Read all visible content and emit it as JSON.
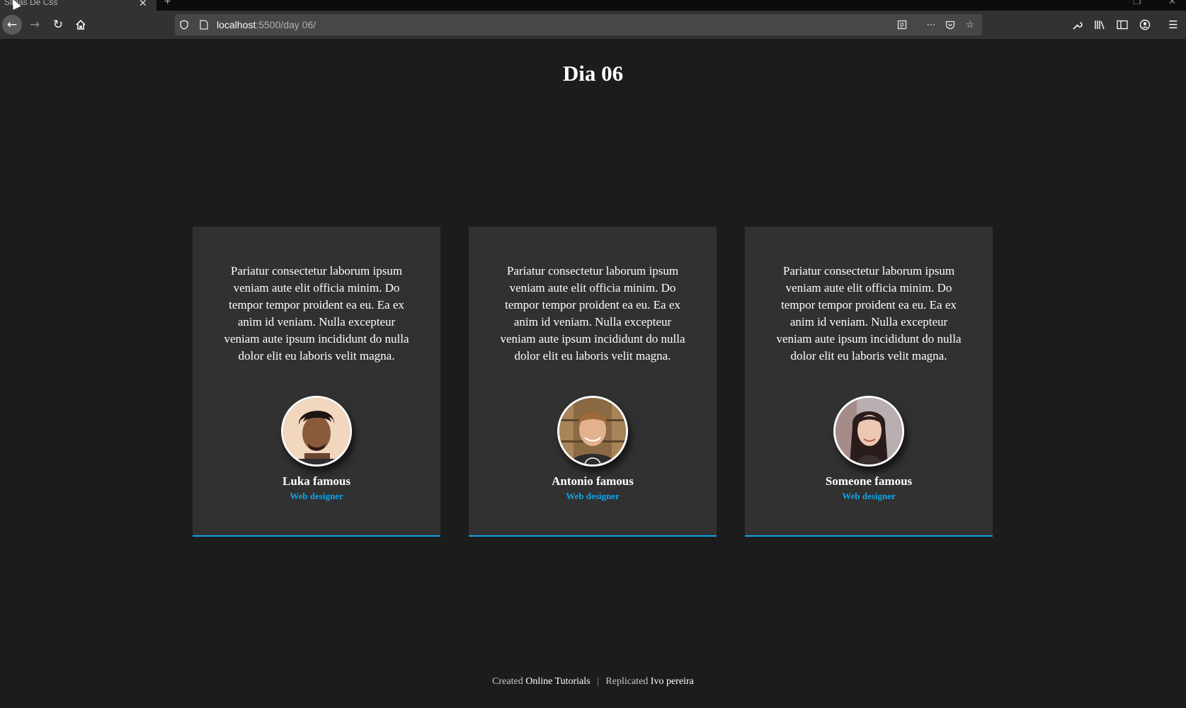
{
  "browser": {
    "tab_title": "Slidas De Css",
    "tab_close": "✕",
    "new_tab": "+",
    "url_host": "localhost",
    "url_path": ":5500/day 06/"
  },
  "page": {
    "title": "Dia 06",
    "accent_color": "#0ea5e9"
  },
  "cards": [
    {
      "text": "Pariatur consectetur laborum ipsum veniam aute elit officia minim. Do tempor tempor proident ea eu. Ea ex anim id veniam. Nulla excepteur veniam aute ipsum incididunt do nulla dolor elit eu laboris velit magna.",
      "name": "Luka famous",
      "role": "Web designer"
    },
    {
      "text": "Pariatur consectetur laborum ipsum veniam aute elit officia minim. Do tempor tempor proident ea eu. Ea ex anim id veniam. Nulla excepteur veniam aute ipsum incididunt do nulla dolor elit eu laboris velit magna.",
      "name": "Antonio famous",
      "role": "Web designer"
    },
    {
      "text": "Pariatur consectetur laborum ipsum veniam aute elit officia minim. Do tempor tempor proident ea eu. Ea ex anim id veniam. Nulla excepteur veniam aute ipsum incididunt do nulla dolor elit eu laboris velit magna.",
      "name": "Someone famous",
      "role": "Web designer"
    }
  ],
  "footer": {
    "created_label": "Created",
    "created_by": "Online Tutorials",
    "separator": "|",
    "replicated_label": "Replicated",
    "replicated_by": "Ivo pereira"
  }
}
